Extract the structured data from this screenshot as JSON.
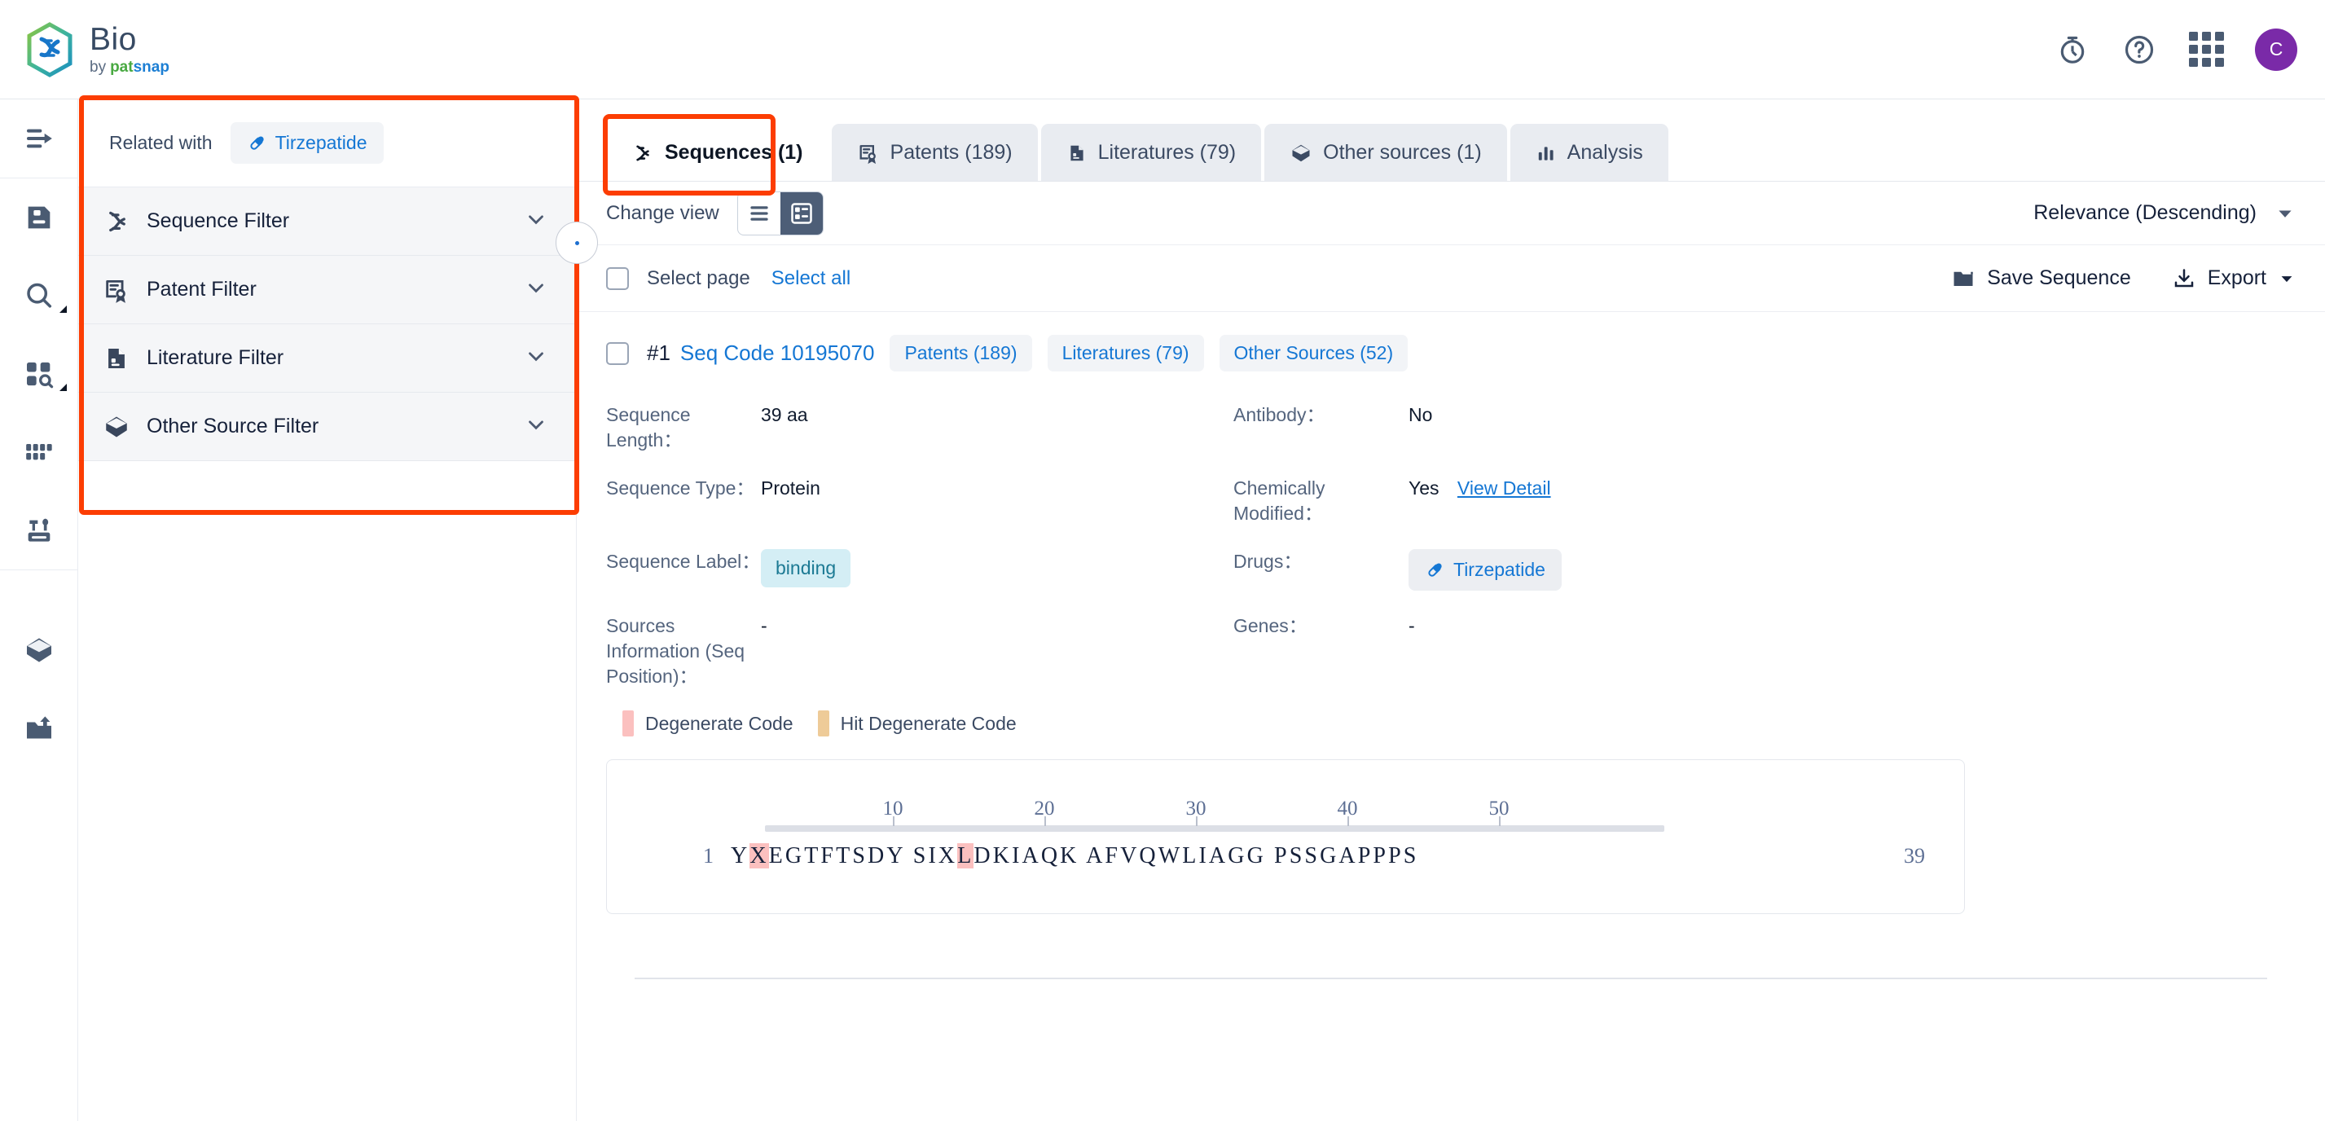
{
  "header": {
    "brand_title": "Bio",
    "brand_by": "by",
    "brand_pat": "pat",
    "brand_snap": "snap",
    "icons": [
      "stopwatch-icon",
      "help-icon",
      "apps-grid-icon"
    ],
    "avatar_initial": "C"
  },
  "rail": {
    "items": [
      {
        "name": "collapse-expand",
        "icon": "menu-arrow-icon"
      },
      {
        "name": "saved-documents",
        "icon": "save-document-icon"
      },
      {
        "name": "search",
        "icon": "magnifier-icon",
        "caret": true
      },
      {
        "name": "structure-search",
        "icon": "blocks-search-icon",
        "caret": true
      },
      {
        "name": "batch-grid",
        "icon": "grid-dots-icon"
      },
      {
        "name": "tools",
        "icon": "tools-icon"
      },
      {
        "name": "library",
        "icon": "cube-icon"
      },
      {
        "name": "upload",
        "icon": "upload-tray-icon"
      }
    ]
  },
  "filter_panel": {
    "related_label": "Related with",
    "drug_chip": {
      "label": "Tirzepatide",
      "icon": "pill-icon"
    },
    "filters": [
      {
        "label": "Sequence Filter",
        "icon": "dna-icon"
      },
      {
        "label": "Patent Filter",
        "icon": "patent-icon"
      },
      {
        "label": "Literature Filter",
        "icon": "literature-icon"
      },
      {
        "label": "Other Source Filter",
        "icon": "cube-icon"
      }
    ]
  },
  "tabs": [
    {
      "label": "Sequences (1)",
      "icon": "dna-icon",
      "active": true
    },
    {
      "label": "Patents (189)",
      "icon": "patent-icon",
      "active": false
    },
    {
      "label": "Literatures (79)",
      "icon": "literature-icon",
      "active": false
    },
    {
      "label": "Other sources (1)",
      "icon": "cube-icon",
      "active": false
    },
    {
      "label": "Analysis",
      "icon": "bar-chart-icon",
      "active": false
    }
  ],
  "toolbar": {
    "change_view_label": "Change view",
    "view_list_icon": "list-view-icon",
    "view_card_icon": "card-view-icon",
    "sort_value": "Relevance (Descending)"
  },
  "select_bar": {
    "select_page": "Select page",
    "select_all": "Select all",
    "save_sequence": "Save Sequence",
    "export": "Export"
  },
  "result": {
    "index": "#1",
    "seq_code": "Seq Code 10195070",
    "pills": [
      "Patents (189)",
      "Literatures (79)",
      "Other Sources (52)"
    ],
    "fields_left": [
      {
        "label": "Sequence Length：",
        "value": "39 aa",
        "type": "text"
      },
      {
        "label": "Sequence Type：",
        "value": "Protein",
        "type": "text"
      },
      {
        "label": "Sequence Label：",
        "value": "binding",
        "type": "tag"
      },
      {
        "label": "Sources Information (Seq Position)：",
        "value": "-",
        "type": "text"
      }
    ],
    "fields_right": [
      {
        "label": "Antibody：",
        "value": "No",
        "type": "text"
      },
      {
        "label": "Chemically Modified：",
        "value": "Yes",
        "link": "View Detail",
        "type": "link"
      },
      {
        "label": "Drugs：",
        "value": "Tirzepatide",
        "type": "chip"
      },
      {
        "label": "Genes：",
        "value": "-",
        "type": "text"
      }
    ],
    "legend": [
      {
        "label": "Degenerate Code",
        "color": "#fbc0bf"
      },
      {
        "label": "Hit Degenerate Code",
        "color": "#eecb98"
      }
    ],
    "sequence": {
      "start": "1",
      "end": "39",
      "ticks": [
        "10",
        "20",
        "30",
        "40",
        "50"
      ],
      "chars": "YXEGTFTSDY SIXLDKIAQK AFVQWLIAGG PSSGAPPPS",
      "highlight_positions": [
        1,
        13
      ]
    }
  },
  "colors": {
    "accent_blue": "#1577d4",
    "highlight_box": "#fc3d03",
    "tag_bg": "#d4eef5",
    "tag_fg": "#1c7a94",
    "avatar_bg": "#7a2aa8",
    "degenerate": "#fbc0bf",
    "hit_degenerate": "#eecb98"
  }
}
